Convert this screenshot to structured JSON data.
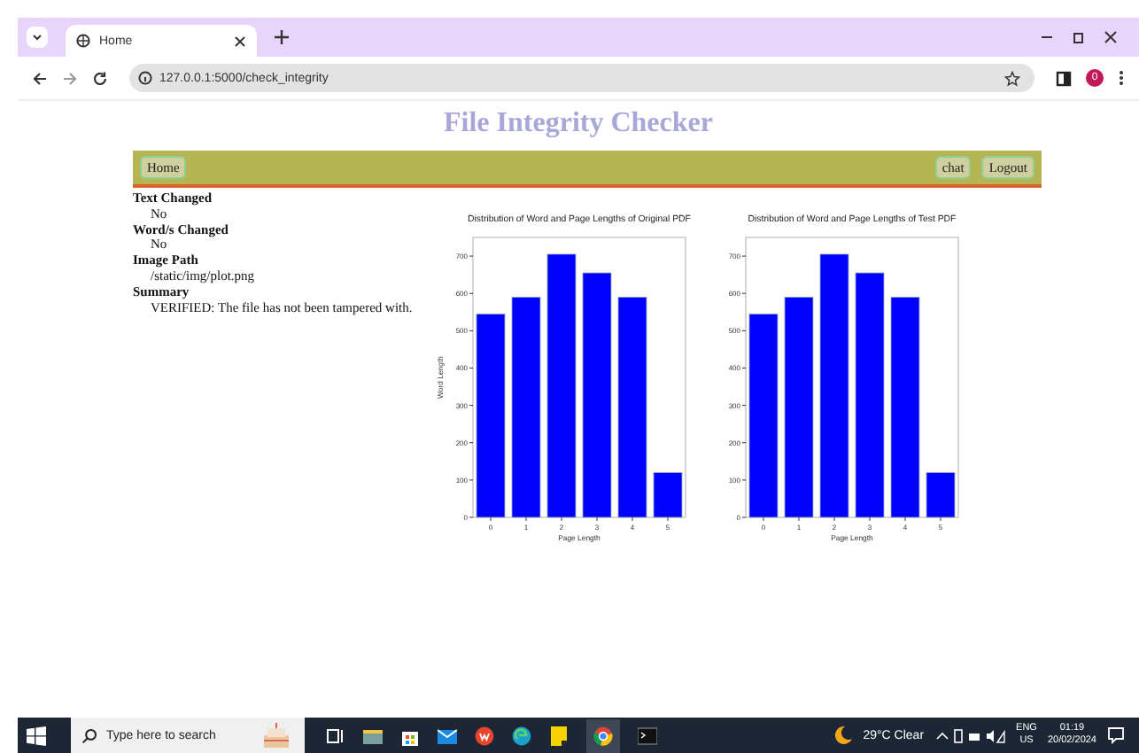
{
  "browser": {
    "tab_title": "Home",
    "url": "127.0.0.1:5000/check_integrity",
    "profile_initial": "0"
  },
  "page_title": "File Integrity Checker",
  "nav": {
    "left": [
      "Home"
    ],
    "right": [
      "chat",
      "Logout"
    ]
  },
  "fields": [
    {
      "label": "Text Changed",
      "value": "No"
    },
    {
      "label": "Word/s Changed",
      "value": "No"
    },
    {
      "label": "Image Path",
      "value": "/static/img/plot.png"
    },
    {
      "label": "Summary",
      "value": "VERIFIED: The file has not been tampered with."
    }
  ],
  "charts": [
    {
      "chart_data": {
        "type": "bar",
        "title": "Distribution of Word and Page Lengths of Original PDF",
        "xlabel": "Page Length",
        "ylabel": "Word Length",
        "categories": [
          "0",
          "1",
          "2",
          "3",
          "4",
          "5"
        ],
        "values": [
          545,
          590,
          705,
          655,
          590,
          120
        ],
        "ylim": [
          0,
          750
        ],
        "yticks": [
          0,
          100,
          200,
          300,
          400,
          500,
          600,
          700
        ]
      }
    },
    {
      "chart_data": {
        "type": "bar",
        "title": "Distribution of Word and Page Lengths of Test PDF",
        "xlabel": "Page Length",
        "categories": [
          "0",
          "1",
          "2",
          "3",
          "4",
          "5"
        ],
        "values": [
          545,
          590,
          705,
          655,
          590,
          120
        ],
        "ylim": [
          0,
          750
        ],
        "yticks": [
          0,
          100,
          200,
          300,
          400,
          500,
          600,
          700
        ]
      }
    }
  ],
  "taskbar": {
    "search_placeholder": "Type here to search",
    "weather": "29°C  Clear",
    "language": "ENG",
    "region": "US",
    "time": "01:19",
    "date": "20/02/2024"
  }
}
